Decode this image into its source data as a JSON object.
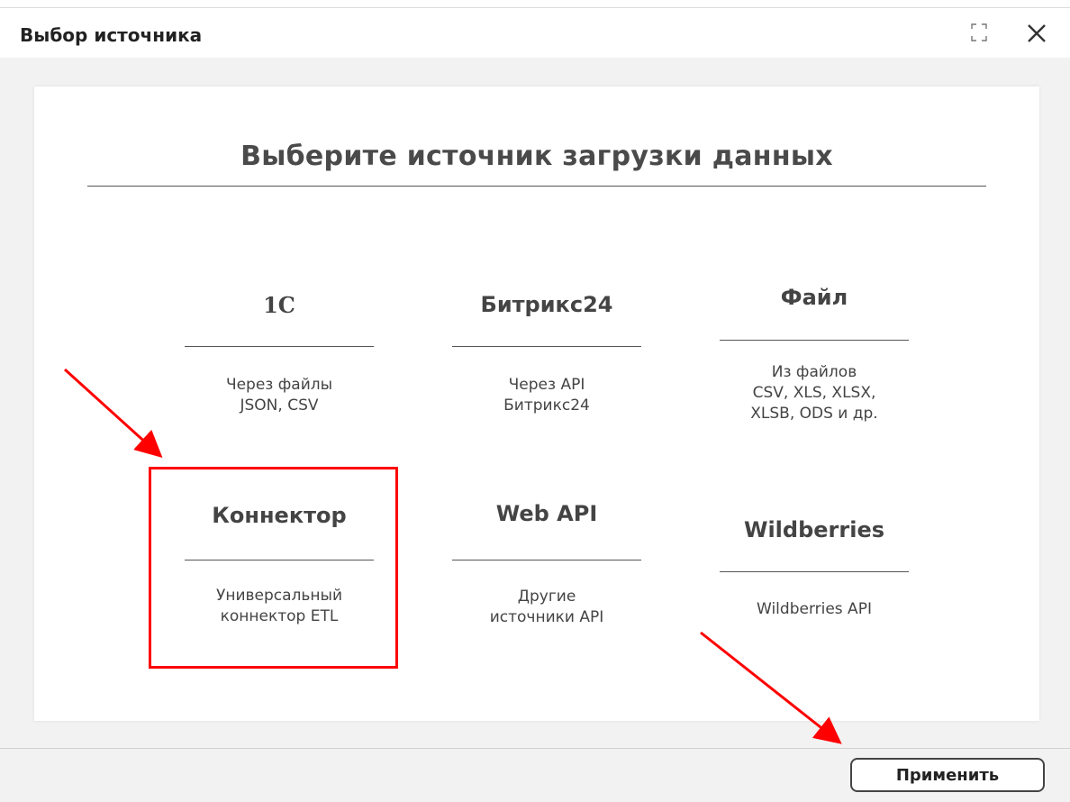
{
  "dialog": {
    "title": "Выбор источника",
    "heading": "Выберите источник загрузки данных",
    "apply_label": "Применить"
  },
  "sources": [
    {
      "name": "1С",
      "desc_line1": "Через файлы",
      "desc_line2": "JSON, CSV",
      "desc_line3": ""
    },
    {
      "name": "Битрикс24",
      "desc_line1": "Через API",
      "desc_line2": "Битрикс24",
      "desc_line3": ""
    },
    {
      "name": "Файл",
      "desc_line1": "Из файлов",
      "desc_line2": "CSV, XLS, XLSX,",
      "desc_line3": "XLSB, ODS и др."
    },
    {
      "name": "Коннектор",
      "desc_line1": "Универсальный",
      "desc_line2": "коннектор ETL",
      "desc_line3": ""
    },
    {
      "name": "Web API",
      "desc_line1": "Другие",
      "desc_line2": "источники API",
      "desc_line3": ""
    },
    {
      "name": "Wildberries",
      "desc_line1": "Wildberries API",
      "desc_line2": "",
      "desc_line3": ""
    }
  ],
  "annotations": {
    "highlight_color": "#ff0000",
    "arrow_color": "#ff0000"
  },
  "icons": {
    "expand": "expand-icon",
    "close": "close-icon"
  }
}
